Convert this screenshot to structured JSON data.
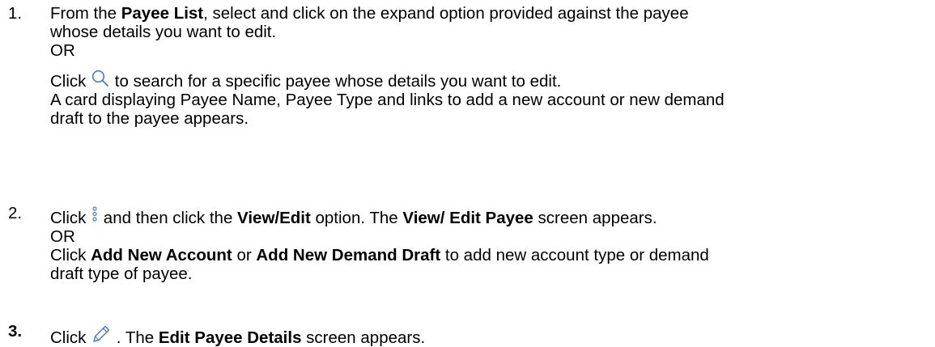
{
  "steps": [
    {
      "number": "1.",
      "line1_prefix": "From the ",
      "line1_bold": "Payee List",
      "line1_suffix": ", select and click on the expand option provided against the payee",
      "line2": "whose details you want to edit.",
      "or_label": "OR",
      "line4_prefix": "Click ",
      "line4_icon": "search-icon",
      "line4_suffix": " to search for a specific payee whose details you want to edit.",
      "line5": "A card displaying Payee Name, Payee Type and links to add a new account or new demand",
      "line6": "draft to the payee appears."
    },
    {
      "number": "2.",
      "line1_prefix": "Click ",
      "line1_icon": "kebab-menu-icon",
      "line1_mid1": " and then click the ",
      "line1_bold1": "View/Edit",
      "line1_mid2": " option. The ",
      "line1_bold2": "View/ Edit Payee",
      "line1_suffix": " screen appears.",
      "or_label": "OR",
      "line3_prefix": "Click ",
      "line3_bold1": "Add New Account",
      "line3_mid": " or ",
      "line3_bold2": "Add New Demand Draft",
      "line3_suffix": " to add new account type or demand",
      "line4": "draft type of payee."
    },
    {
      "number": "3.",
      "line1_prefix": "Click ",
      "line1_icon": "pencil-edit-icon",
      "line1_mid": " . The ",
      "line1_bold": "Edit Payee Details",
      "line1_suffix": " screen appears."
    }
  ],
  "icon_color": "#4a7bbd"
}
